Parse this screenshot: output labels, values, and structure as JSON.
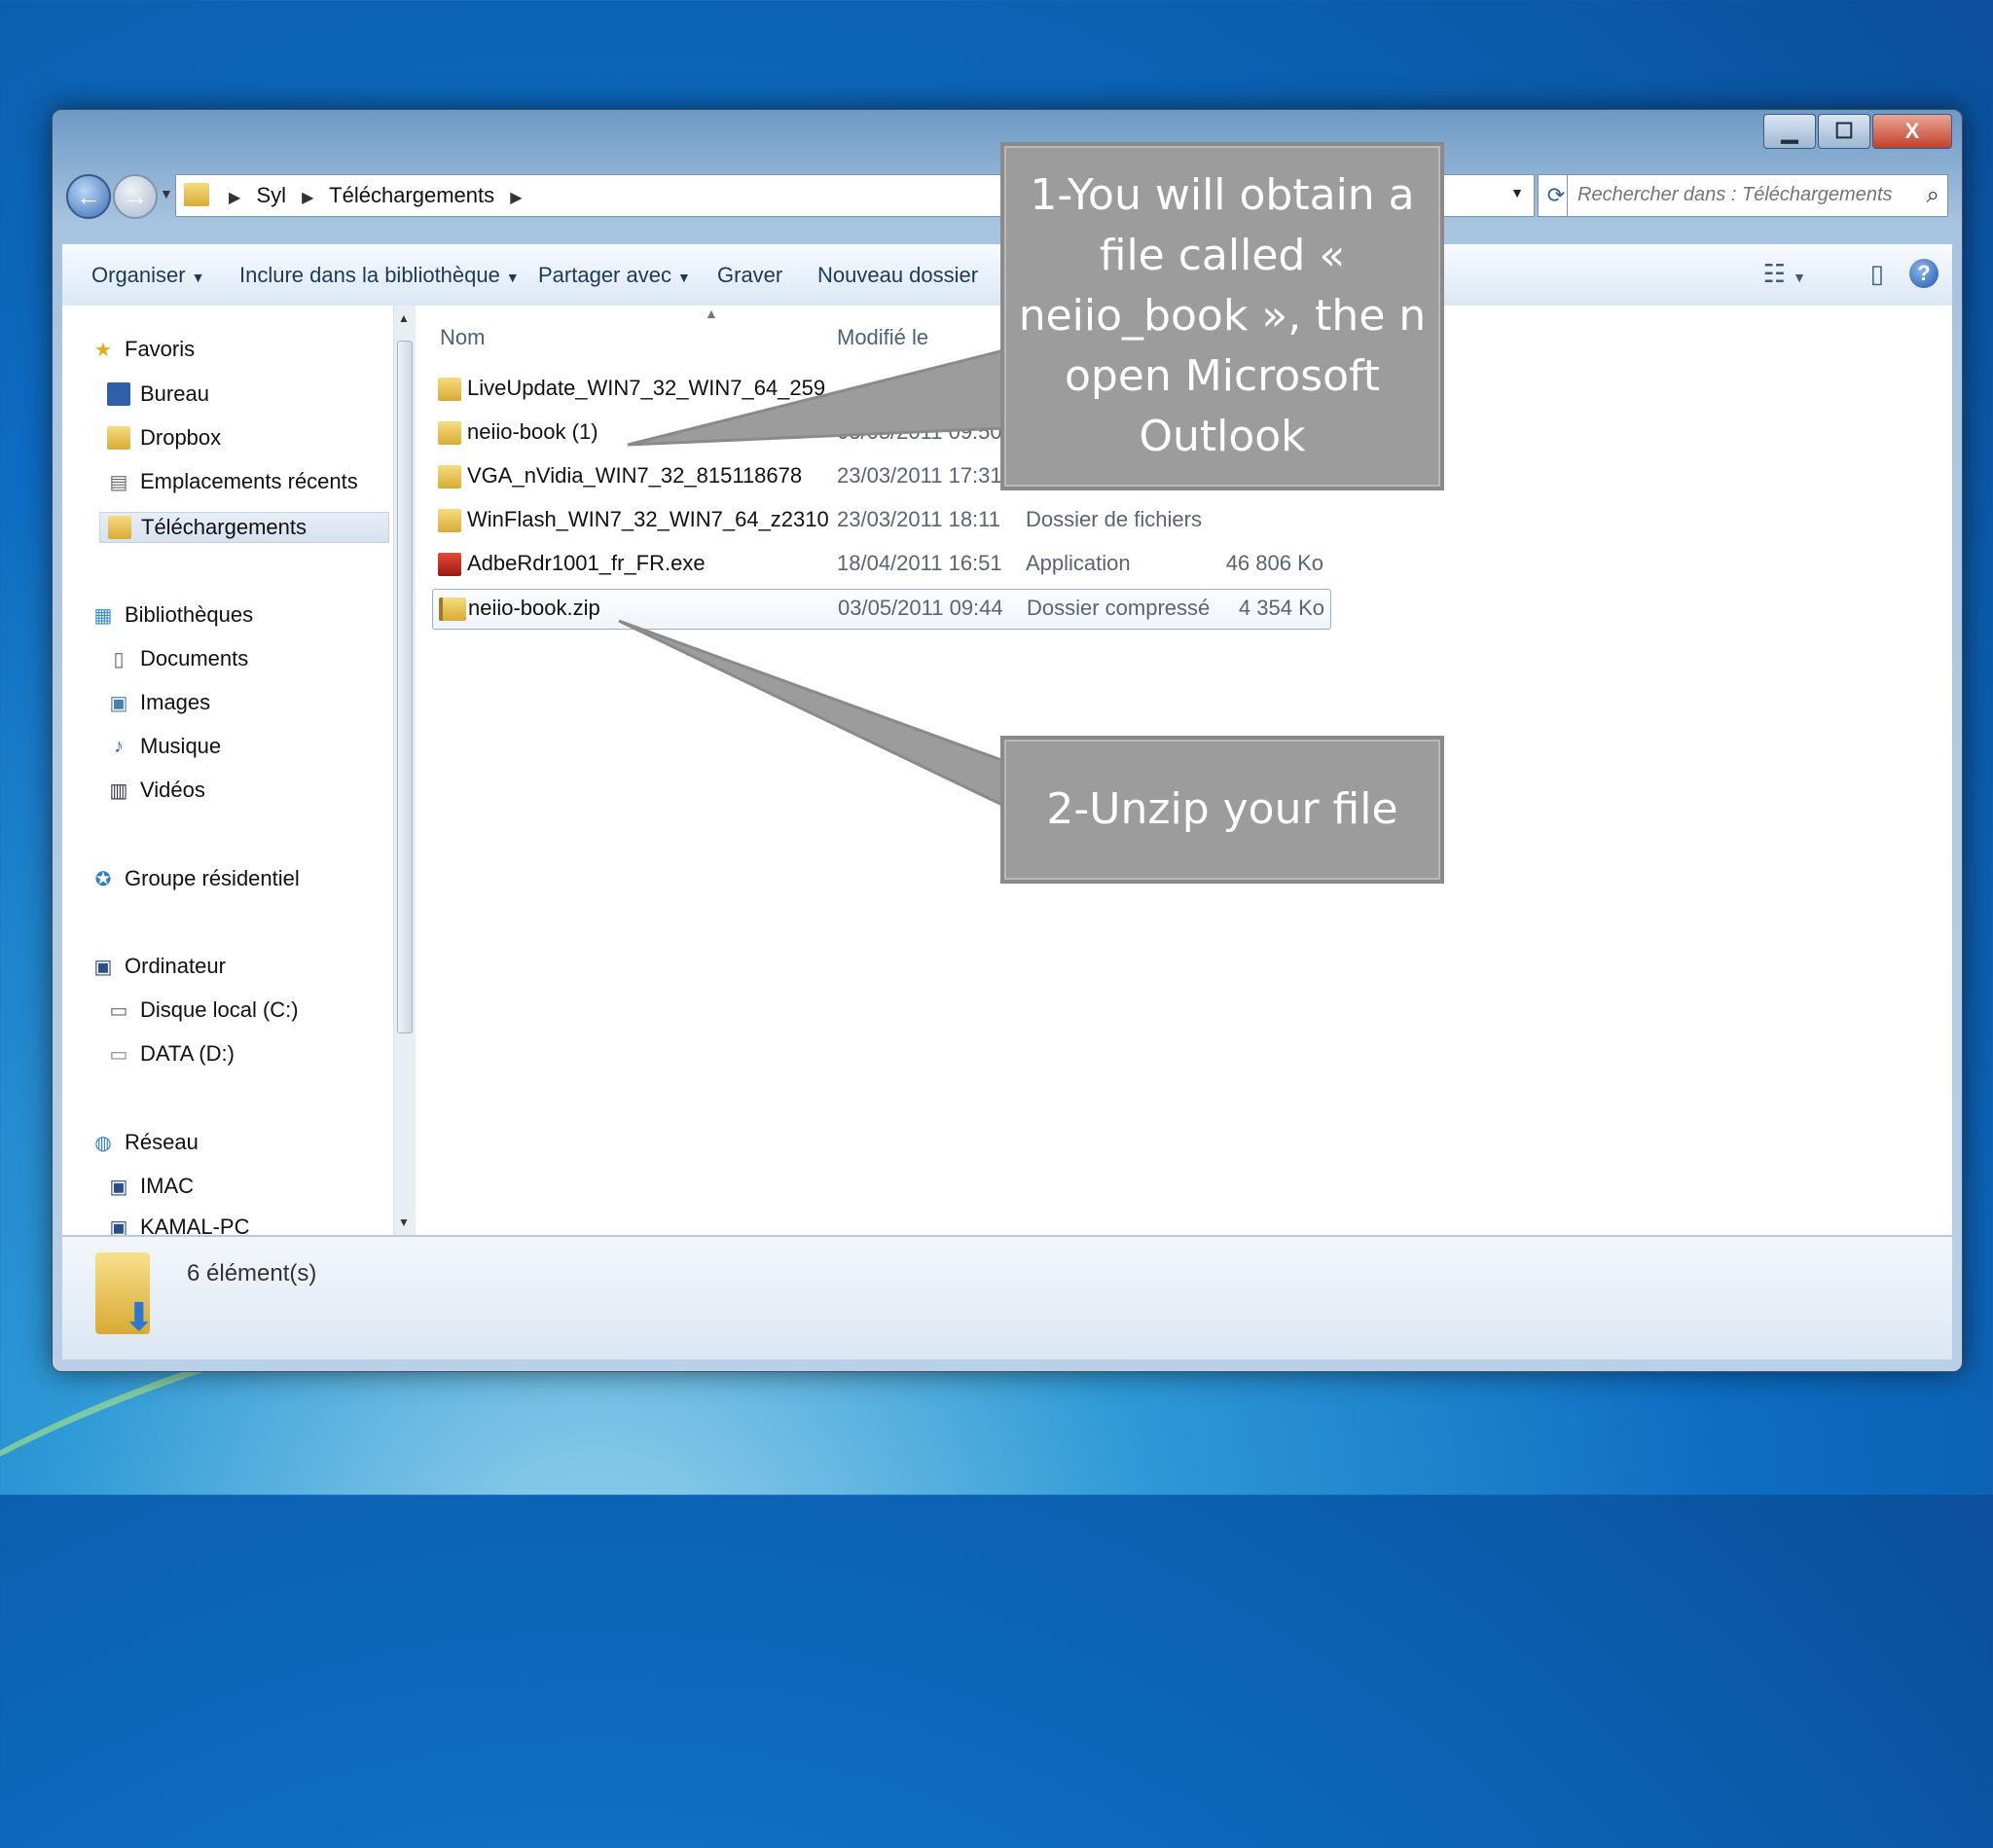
{
  "window": {
    "caption_buttons": {
      "minimize": "▁",
      "maximize": "☐",
      "close": "X"
    }
  },
  "address": {
    "crumbs": [
      "Syl",
      "Téléchargements"
    ],
    "search_placeholder": "Rechercher dans : Téléchargements"
  },
  "toolbar": {
    "organise": "Organiser",
    "include_library": "Inclure dans la bibliothèque",
    "share_with": "Partager avec",
    "burn": "Graver",
    "new_folder": "Nouveau dossier"
  },
  "sidebar": {
    "favorites": {
      "label": "Favoris",
      "items": [
        "Bureau",
        "Dropbox",
        "Emplacements récents",
        "Téléchargements"
      ]
    },
    "libraries": {
      "label": "Bibliothèques",
      "items": [
        "Documents",
        "Images",
        "Musique",
        "Vidéos"
      ]
    },
    "homegroup": "Groupe résidentiel",
    "computer": {
      "label": "Ordinateur",
      "items": [
        "Disque local (C:)",
        "DATA (D:)"
      ]
    },
    "network": {
      "label": "Réseau",
      "items": [
        "IMAC",
        "KAMAL-PC"
      ]
    }
  },
  "file_list": {
    "columns": {
      "name": "Nom",
      "modified": "Modifié le"
    },
    "files": [
      {
        "name": "LiveUpdate_WIN7_32_WIN7_64_259",
        "date": "",
        "type": "",
        "size": "",
        "icon": "folder-icon"
      },
      {
        "name": "neiio-book (1)",
        "date": "03/05/2011 09:50",
        "type": "",
        "size": "",
        "icon": "folder-icon"
      },
      {
        "name": "VGA_nVidia_WIN7_32_815118678",
        "date": "23/03/2011 17:31",
        "type": "",
        "size": "",
        "icon": "folder-icon"
      },
      {
        "name": "WinFlash_WIN7_32_WIN7_64_z2310",
        "date": "23/03/2011 18:11",
        "type": "Dossier de fichiers",
        "size": "",
        "icon": "folder-icon"
      },
      {
        "name": "AdbeRdr1001_fr_FR.exe",
        "date": "18/04/2011 16:51",
        "type": "Application",
        "size": "46 806 Ko",
        "icon": "acrobat-icon"
      },
      {
        "name": "neiio-book.zip",
        "date": "03/05/2011 09:44",
        "type": "Dossier compressé",
        "size": "4 354 Ko",
        "icon": "zip-folder-icon"
      }
    ]
  },
  "status": {
    "count": "6 élément(s)"
  },
  "callouts": {
    "step1": "1-You will obtain a file called « neiio_book », the n open Microsoft Outlook",
    "step2": "2-Unzip your file"
  },
  "colors": {
    "callout_fill": "#9c9c9c",
    "callout_text": "#ffffff",
    "selection_border": "#9ab0c8"
  }
}
